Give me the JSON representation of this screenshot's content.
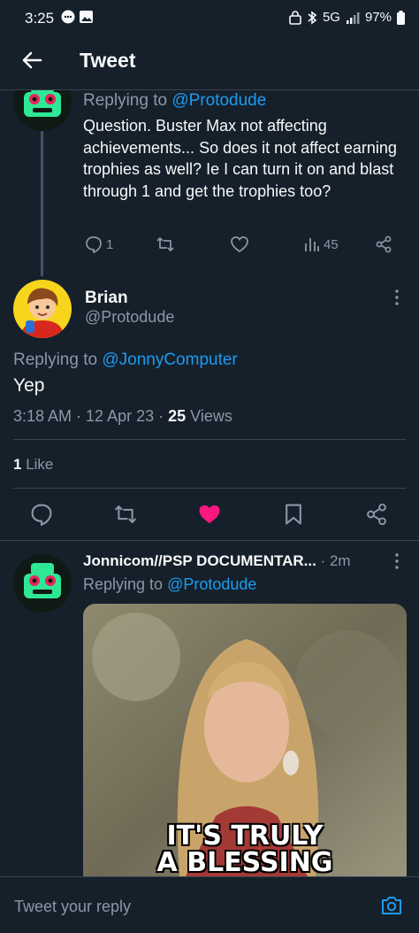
{
  "status_bar": {
    "time": "3:25",
    "network": "5G",
    "battery": "97%"
  },
  "header": {
    "title": "Tweet"
  },
  "parent_tweet": {
    "replying_prefix": "Replying to",
    "replying_handle": "@Protodude",
    "text": "Question.  Buster Max not affecting achievements... So does it not affect earning trophies as well? Ie I can turn it on and blast through 1 and get the trophies too?",
    "reply_count": "1",
    "views": "45"
  },
  "main_tweet": {
    "author_name": "Brian",
    "author_handle": "@Protodude",
    "replying_prefix": "Replying to",
    "replying_handle": "@JonnyComputer",
    "text": "Yep",
    "timestamp": "3:18 AM · 12 Apr 23 ·",
    "views_count": "25",
    "views_label": "Views",
    "likes_count": "1",
    "likes_label": "Like"
  },
  "reply_tweet": {
    "author_name": "Jonnicom//PSP DOCUMENTAR...",
    "time_ago": "· 2m",
    "replying_prefix": "Replying to",
    "replying_handle": "@Protodude",
    "gif_caption_line1": "IT'S TRULY",
    "gif_caption_line2": "A BLESSING"
  },
  "composer": {
    "placeholder": "Tweet your reply"
  },
  "colors": {
    "background": "#15202b",
    "accent": "#1d9bf0",
    "like_active": "#f91880",
    "muted_text": "#8b98a5"
  }
}
